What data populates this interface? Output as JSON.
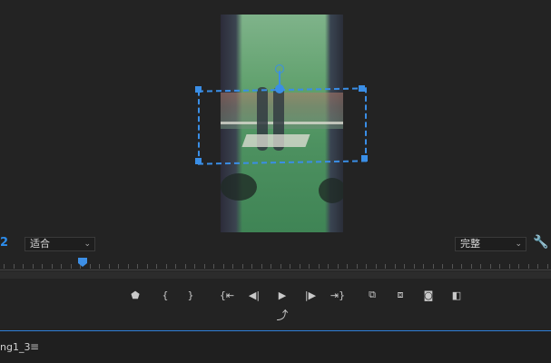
{
  "viewer": {
    "timecode_tail": "2",
    "fit_dropdown": {
      "value": "适合"
    },
    "quality_dropdown": {
      "value": "完整"
    },
    "playhead_position": 0.15
  },
  "icons": {
    "settings": "wrench-icon",
    "dropdown": "chevron-down-icon"
  },
  "transport": [
    {
      "name": "add-marker-button",
      "icon": "marker-icon",
      "glyph": "⬟"
    },
    {
      "name": "mark-in-button",
      "icon": "mark-in-icon",
      "glyph": "{"
    },
    {
      "name": "mark-out-button",
      "icon": "mark-out-icon",
      "glyph": "}"
    },
    {
      "name": "go-to-in-button",
      "icon": "go-to-in-icon",
      "glyph": "{⇤"
    },
    {
      "name": "step-back-button",
      "icon": "step-back-icon",
      "glyph": "◀|"
    },
    {
      "name": "play-button",
      "icon": "play-icon",
      "glyph": "▶"
    },
    {
      "name": "step-forward-button",
      "icon": "step-forward-icon",
      "glyph": "|▶"
    },
    {
      "name": "go-to-out-button",
      "icon": "go-to-out-icon",
      "glyph": "⇥}"
    },
    {
      "name": "insert-button",
      "icon": "insert-icon",
      "glyph": "⧉"
    },
    {
      "name": "overwrite-button",
      "icon": "overwrite-icon",
      "glyph": "⧈"
    },
    {
      "name": "export-frame-camera-button",
      "icon": "camera-icon",
      "glyph": "◙"
    },
    {
      "name": "comparison-view-button",
      "icon": "comparison-icon",
      "glyph": "◧"
    }
  ],
  "export_button": {
    "icon": "export-icon",
    "glyph": "⤴"
  },
  "sequence": {
    "tab_label": "ng1_3",
    "menu_glyph": "≡"
  },
  "colors": {
    "accent": "#3a8ee6",
    "background": "#232323"
  }
}
